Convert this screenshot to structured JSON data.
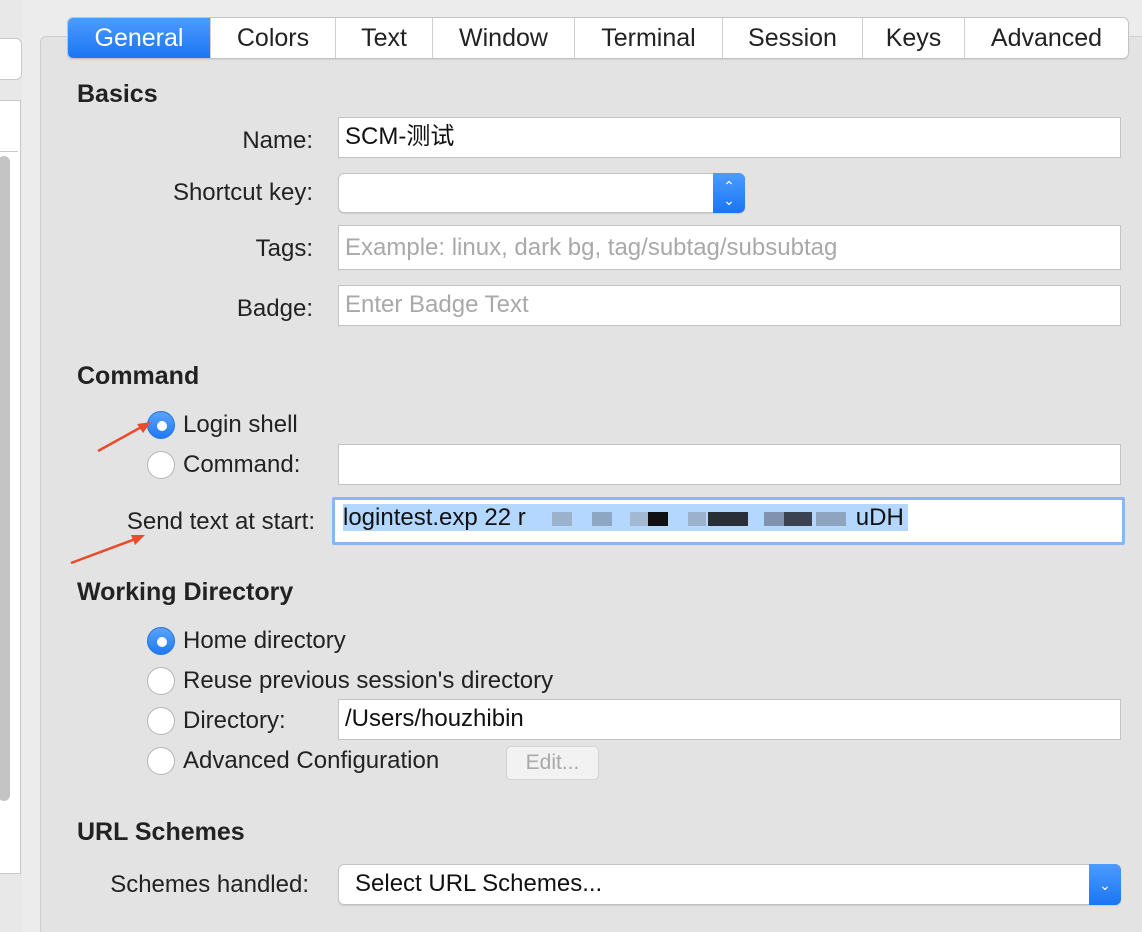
{
  "tabs": [
    {
      "label": "General",
      "active": true
    },
    {
      "label": "Colors",
      "active": false
    },
    {
      "label": "Text",
      "active": false
    },
    {
      "label": "Window",
      "active": false
    },
    {
      "label": "Terminal",
      "active": false
    },
    {
      "label": "Session",
      "active": false
    },
    {
      "label": "Keys",
      "active": false
    },
    {
      "label": "Advanced",
      "active": false
    }
  ],
  "basics": {
    "title": "Basics",
    "name_label": "Name:",
    "name_value": "SCM-测试",
    "shortcut_label": "Shortcut key:",
    "shortcut_value": "",
    "tags_label": "Tags:",
    "tags_placeholder": "Example: linux, dark bg, tag/subtag/subsubtag",
    "badge_label": "Badge:",
    "badge_placeholder": "Enter Badge Text"
  },
  "command": {
    "title": "Command",
    "login_shell_label": "Login shell",
    "command_label": "Command:",
    "command_value": "",
    "send_text_label": "Send text at start:",
    "send_text_visible_start": "logintest.exp 22 r",
    "send_text_visible_end": "uDH",
    "selected_option": "login_shell"
  },
  "working_directory": {
    "title": "Working Directory",
    "home_label": "Home directory",
    "reuse_label": "Reuse previous session's directory",
    "directory_label": "Directory:",
    "directory_value": "/Users/houzhibin",
    "advanced_label": "Advanced Configuration",
    "edit_button": "Edit...",
    "selected_option": "home"
  },
  "url_schemes": {
    "title": "URL Schemes",
    "schemes_label": "Schemes handled:",
    "schemes_value": "Select URL Schemes..."
  },
  "colors": {
    "accent": "#1b76f2",
    "annotation_arrow": "#ea4b2b",
    "selection": "#b3d7ff"
  }
}
